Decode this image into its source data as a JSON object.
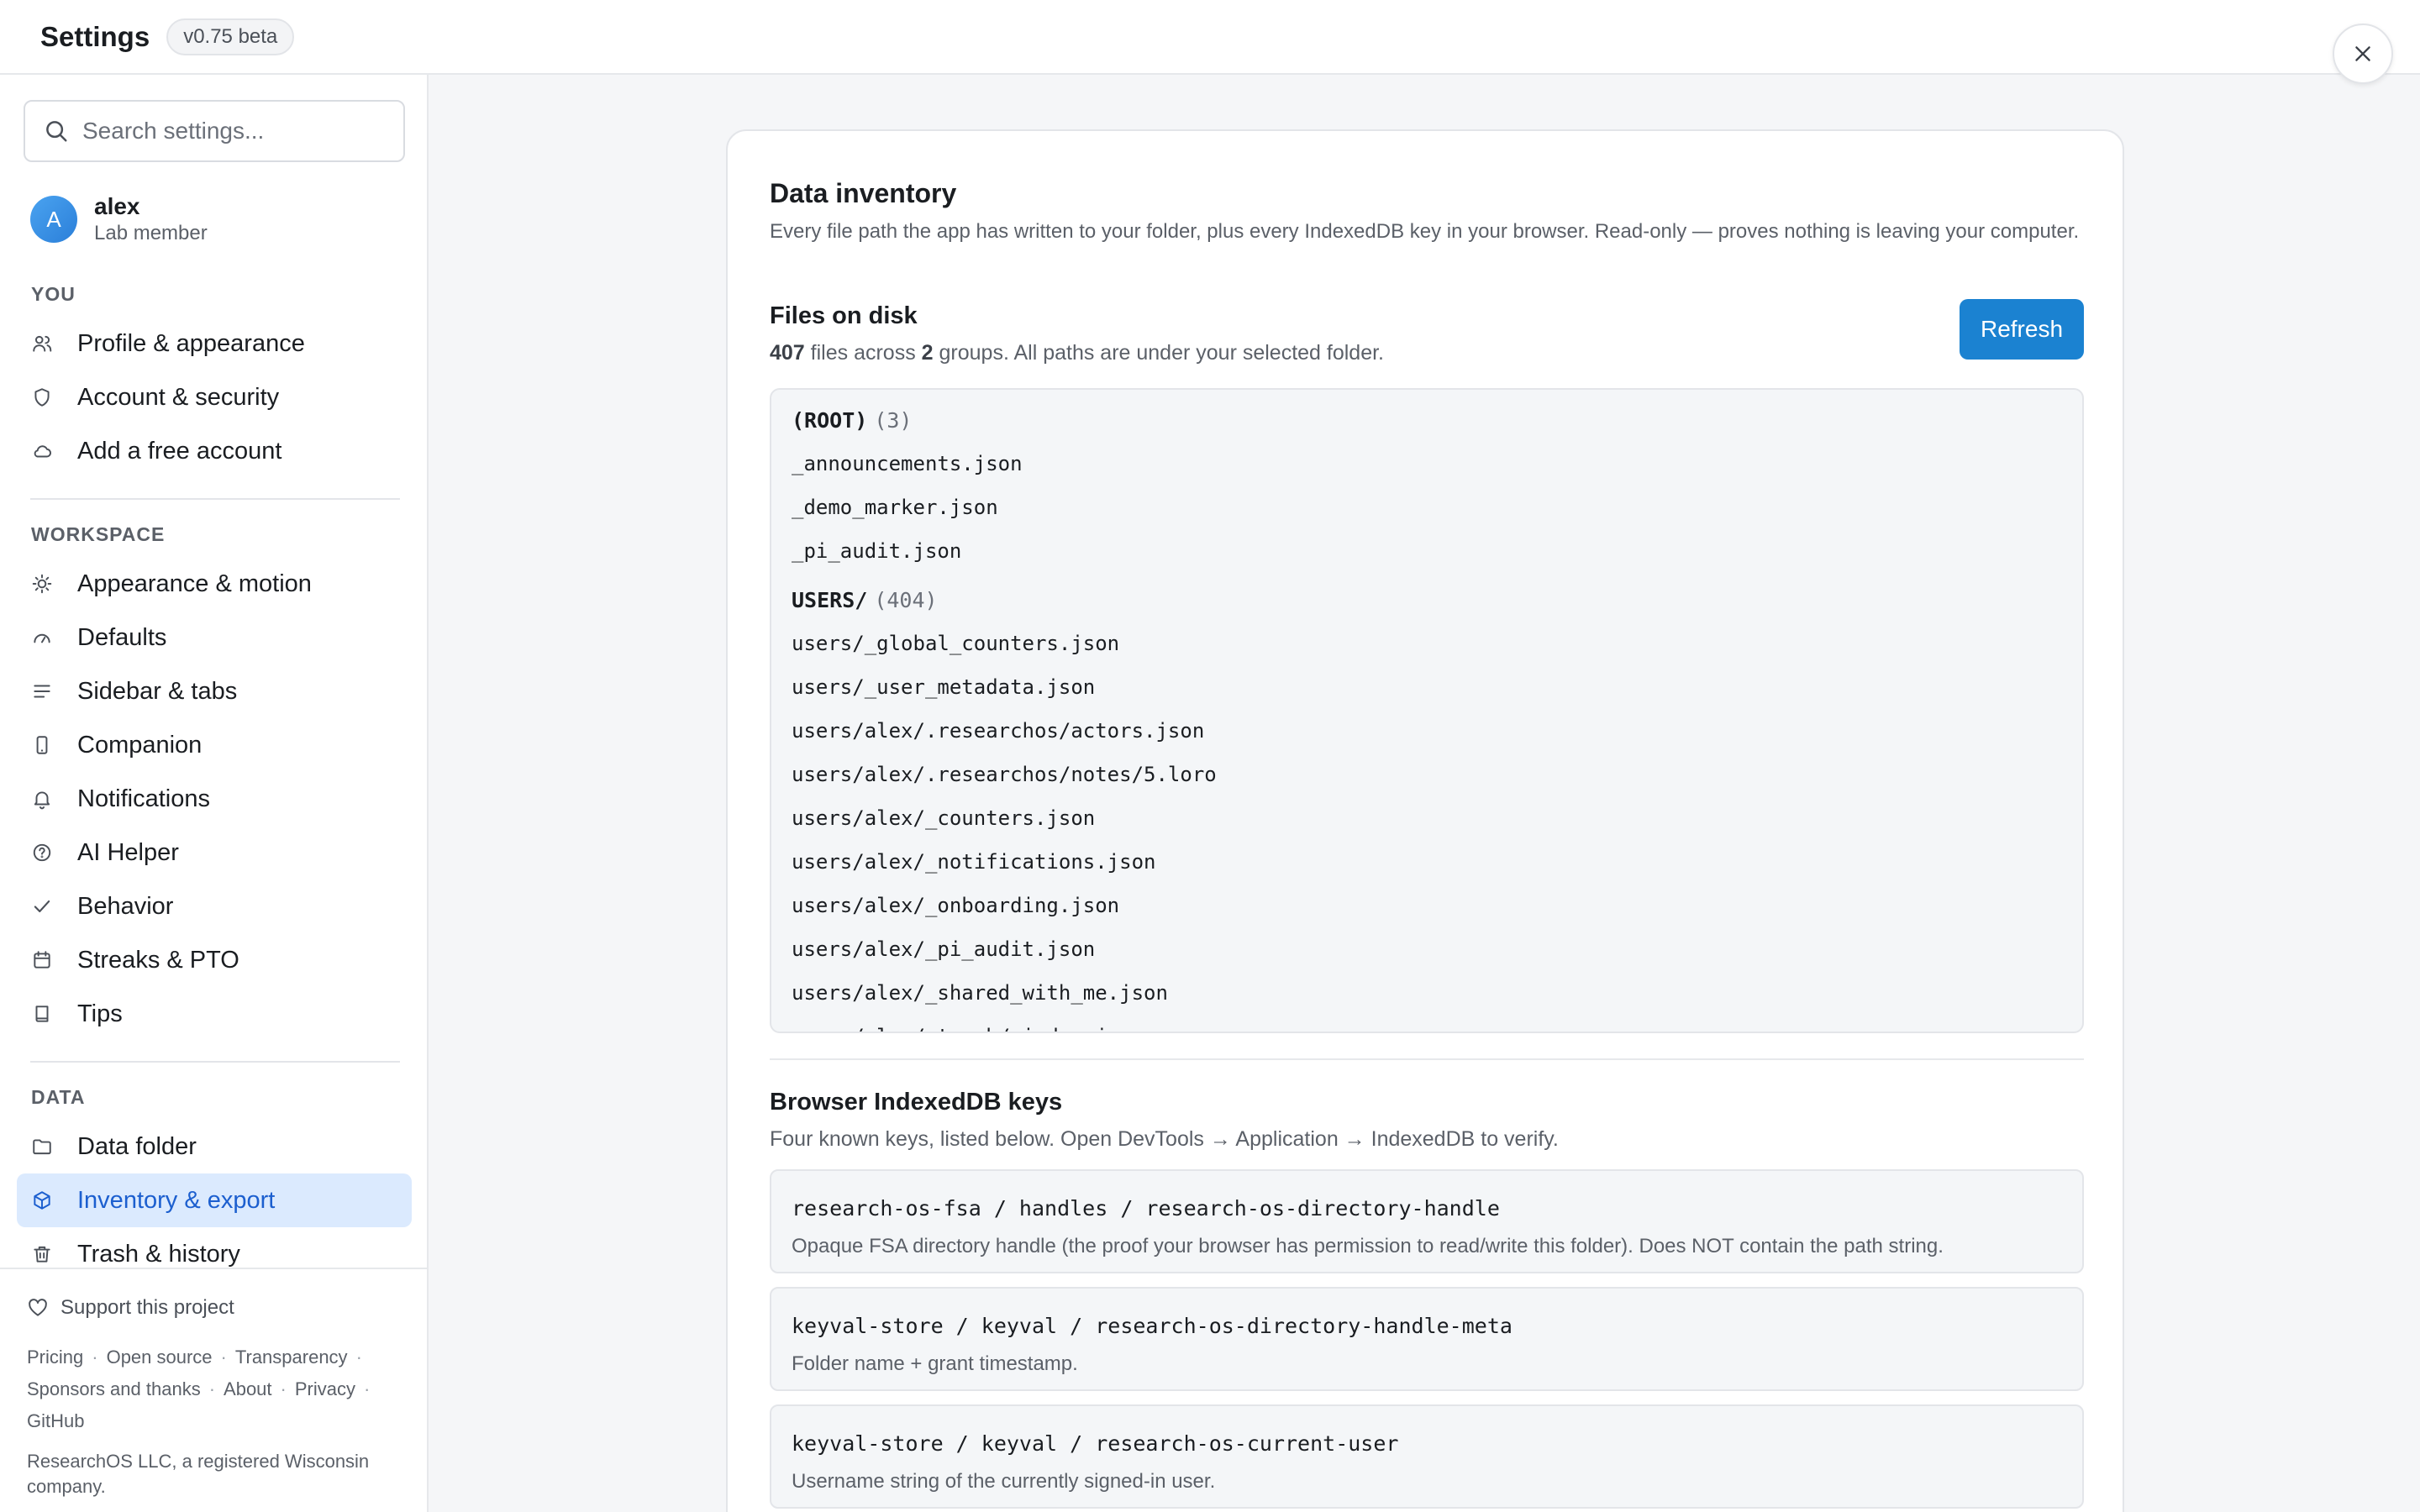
{
  "header": {
    "title": "Settings",
    "version": "v0.75 beta"
  },
  "sidebar": {
    "search_placeholder": "Search settings...",
    "user": {
      "initial": "A",
      "name": "alex",
      "role": "Lab member"
    },
    "sections": [
      {
        "label": "YOU",
        "items": [
          "Profile & appearance",
          "Account & security",
          "Add a free account"
        ]
      },
      {
        "label": "WORKSPACE",
        "items": [
          "Appearance & motion",
          "Defaults",
          "Sidebar & tabs",
          "Companion",
          "Notifications",
          "AI Helper",
          "Behavior",
          "Streaks & PTO",
          "Tips"
        ]
      },
      {
        "label": "DATA",
        "items": [
          "Data folder",
          "Inventory & export",
          "Trash & history"
        ]
      }
    ],
    "active_item": "Inventory & export",
    "footer": {
      "support": "Support this project",
      "links": [
        "Pricing",
        "Open source",
        "Transparency",
        "Sponsors and thanks",
        "About",
        "Privacy",
        "GitHub"
      ],
      "note": "ResearchOS LLC, a registered Wisconsin company."
    }
  },
  "main": {
    "title": "Data inventory",
    "description": "Every file path the app has written to your folder, plus every IndexedDB key in your browser. Read-only — proves nothing is leaving your computer.",
    "files": {
      "title": "Files on disk",
      "summary_count": "407",
      "summary_mid": " files across ",
      "summary_groups": "2",
      "summary_end": " groups. All paths are under your selected folder.",
      "refresh_label": "Refresh",
      "groups": [
        {
          "name": "(ROOT)",
          "count": "(3)",
          "files": [
            "_announcements.json",
            "_demo_marker.json",
            "_pi_audit.json"
          ]
        },
        {
          "name": "USERS/",
          "count": "(404)",
          "files": [
            "users/_global_counters.json",
            "users/_user_metadata.json",
            "users/alex/.researchos/actors.json",
            "users/alex/.researchos/notes/5.loro",
            "users/alex/_counters.json",
            "users/alex/_notifications.json",
            "users/alex/_onboarding.json",
            "users/alex/_pi_audit.json",
            "users/alex/_shared_with_me.json",
            "users/alex/_trash/_index.json"
          ]
        }
      ]
    },
    "idb": {
      "title": "Browser IndexedDB keys",
      "description": "Four known keys, listed below. Open DevTools → Application → IndexedDB to verify.",
      "keys": [
        {
          "path": "research-os-fsa / handles / research-os-directory-handle",
          "desc": "Opaque FSA directory handle (the proof your browser has permission to read/write this folder). Does NOT contain the path string."
        },
        {
          "path": "keyval-store / keyval / research-os-directory-handle-meta",
          "desc": "Folder name + grant timestamp."
        },
        {
          "path": "keyval-store / keyval / research-os-current-user",
          "desc": "Username string of the currently signed-in user."
        }
      ]
    }
  }
}
